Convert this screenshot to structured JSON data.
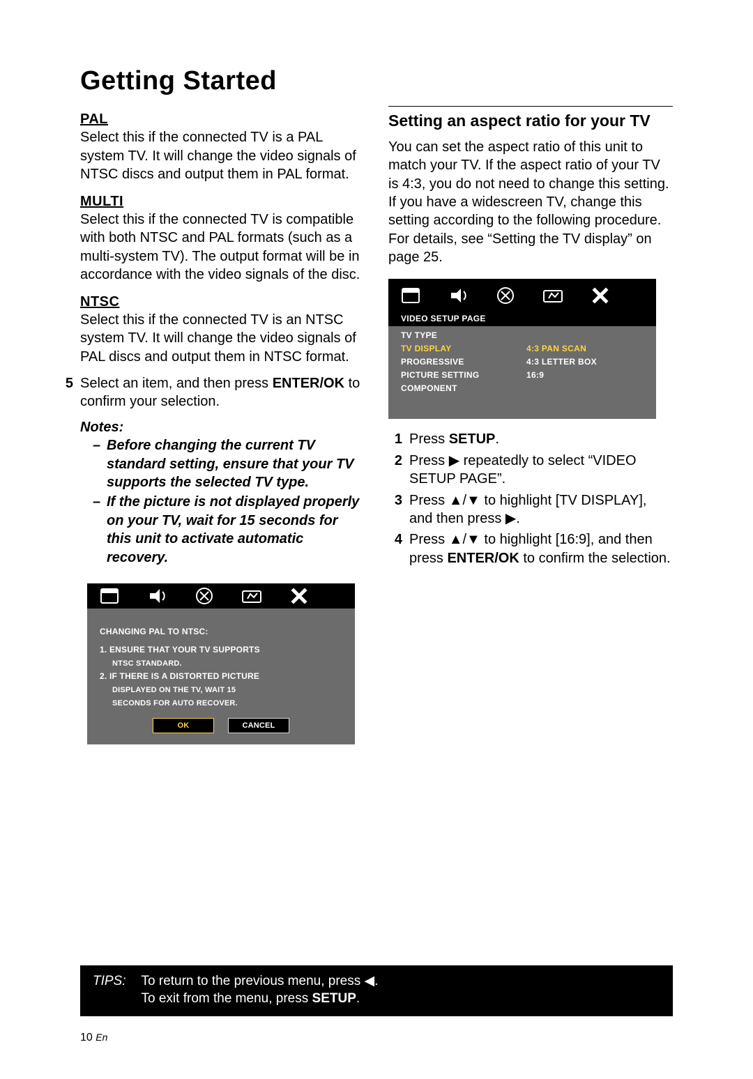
{
  "title": "Getting Started",
  "left": {
    "pal": {
      "head": "PAL",
      "body": "Select this if the connected TV is a PAL system TV. It will change the video signals of NTSC discs and output them in PAL format."
    },
    "multi": {
      "head": "MULTI",
      "body": "Select this if the connected TV is compatible with both NTSC and PAL formats (such as a multi-system TV). The output format will be in accordance with the video signals of the disc."
    },
    "ntsc": {
      "head": "NTSC",
      "body": "Select this if the connected TV is an NTSC system TV. It will change the video signals of PAL discs and output them in NTSC format."
    },
    "step5": {
      "num": "5",
      "pre": "Select an item, and then press ",
      "bold": "ENTER/OK",
      "post": " to confirm your selection."
    },
    "notes": {
      "head": "Notes:",
      "items": [
        "Before changing the current TV standard setting, ensure that your TV supports the selected TV type.",
        "If the picture is not displayed properly on your TV, wait for 15 seconds for this unit to activate automatic recovery."
      ]
    },
    "dialog": {
      "title": "CHANGING PAL TO NTSC:",
      "line1": "1. ENSURE THAT YOUR TV SUPPORTS",
      "line1b": "NTSC STANDARD.",
      "line2": "2. IF THERE IS A DISTORTED PICTURE",
      "line2b": "DISPLAYED ON THE TV, WAIT 15",
      "line2c": "SECONDS FOR AUTO RECOVER.",
      "ok": "OK",
      "cancel": "CANCEL"
    }
  },
  "right": {
    "section_head": "Setting an aspect ratio for your TV",
    "intro1": "You can set the aspect ratio of this unit to match your TV. If the aspect ratio of your TV is 4:3, you do not need to change this setting. If you have a widescreen TV, change this setting according to the following procedure.",
    "intro2": "For details, see “Setting the TV display” on page 25.",
    "menu": {
      "title": "VIDEO SETUP PAGE",
      "rows": [
        {
          "l": "TV TYPE",
          "r": ""
        },
        {
          "l": "TV DISPLAY",
          "r": "4:3 PAN SCAN",
          "hl": true
        },
        {
          "l": "PROGRESSIVE",
          "r": "4:3 LETTER BOX"
        },
        {
          "l": "PICTURE SETTING",
          "r": "16:9"
        },
        {
          "l": "COMPONENT",
          "r": ""
        }
      ]
    },
    "steps": {
      "s1": {
        "num": "1",
        "pre": "Press ",
        "bold": "SETUP",
        "post": "."
      },
      "s2": {
        "num": "2",
        "pre": "Press ",
        "arrow": "▶",
        "post": " repeatedly to select “VIDEO SETUP PAGE”."
      },
      "s3": {
        "num": "3",
        "pre": "Press ",
        "arrows": "▲/▼",
        "mid": " to highlight [TV DISPLAY], and then press ",
        "arrow": "▶",
        "post": "."
      },
      "s4": {
        "num": "4",
        "pre": "Press ",
        "arrows": "▲/▼",
        "mid": " to highlight [16:9], and then press ",
        "bold": "ENTER/OK",
        "post": " to confirm the selection."
      }
    }
  },
  "tips": {
    "label": "TIPS:",
    "line1a": "To return to the previous menu, press ",
    "line1arrow": "◀",
    "line1b": ".",
    "line2a": "To exit from the menu, press ",
    "line2bold": "SETUP",
    "line2b": "."
  },
  "page": {
    "num": "10",
    "lang": "En"
  }
}
